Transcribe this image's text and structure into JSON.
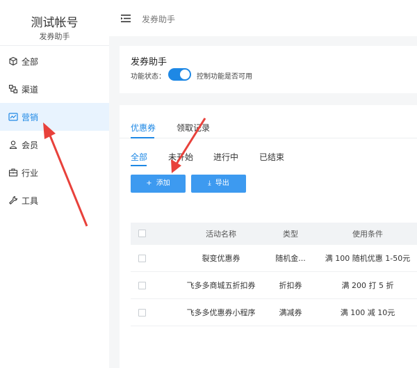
{
  "account": {
    "name": "测试帐号",
    "subtitle": "发券助手"
  },
  "nav": [
    {
      "label": "全部",
      "icon": "cube-icon"
    },
    {
      "label": "渠道",
      "icon": "channel-icon"
    },
    {
      "label": "营销",
      "icon": "chart-icon",
      "active": true
    },
    {
      "label": "会员",
      "icon": "user-icon"
    },
    {
      "label": "行业",
      "icon": "briefcase-icon"
    },
    {
      "label": "工具",
      "icon": "wrench-icon"
    }
  ],
  "topbar": {
    "title": "发券助手"
  },
  "helper": {
    "title": "发券助手",
    "status_label": "功能状态：",
    "status_enabled": true,
    "status_desc": "控制功能是否可用"
  },
  "tabs_primary": [
    "优惠券",
    "领取记录"
  ],
  "tabs_status": [
    "全部",
    "未开始",
    "进行中",
    "已结束"
  ],
  "buttons": {
    "add": "添加",
    "export": "导出",
    "add_icon": "+",
    "export_icon": "⤓"
  },
  "table": {
    "headers": [
      "活动名称",
      "类型",
      "使用条件"
    ],
    "rows": [
      [
        "裂变优惠券",
        "随机金...",
        "满 100 随机优惠 1-50元"
      ],
      [
        "飞多多商城五折扣券",
        "折扣券",
        "满 200 打 5 折"
      ],
      [
        "飞多多优惠券小程序",
        "满减券",
        "满 100 减 10元"
      ]
    ]
  },
  "colors": {
    "accent": "#1e88e5",
    "button": "#3d9af0",
    "arrow": "#e8413b",
    "active_bg": "#e8f3fe"
  }
}
